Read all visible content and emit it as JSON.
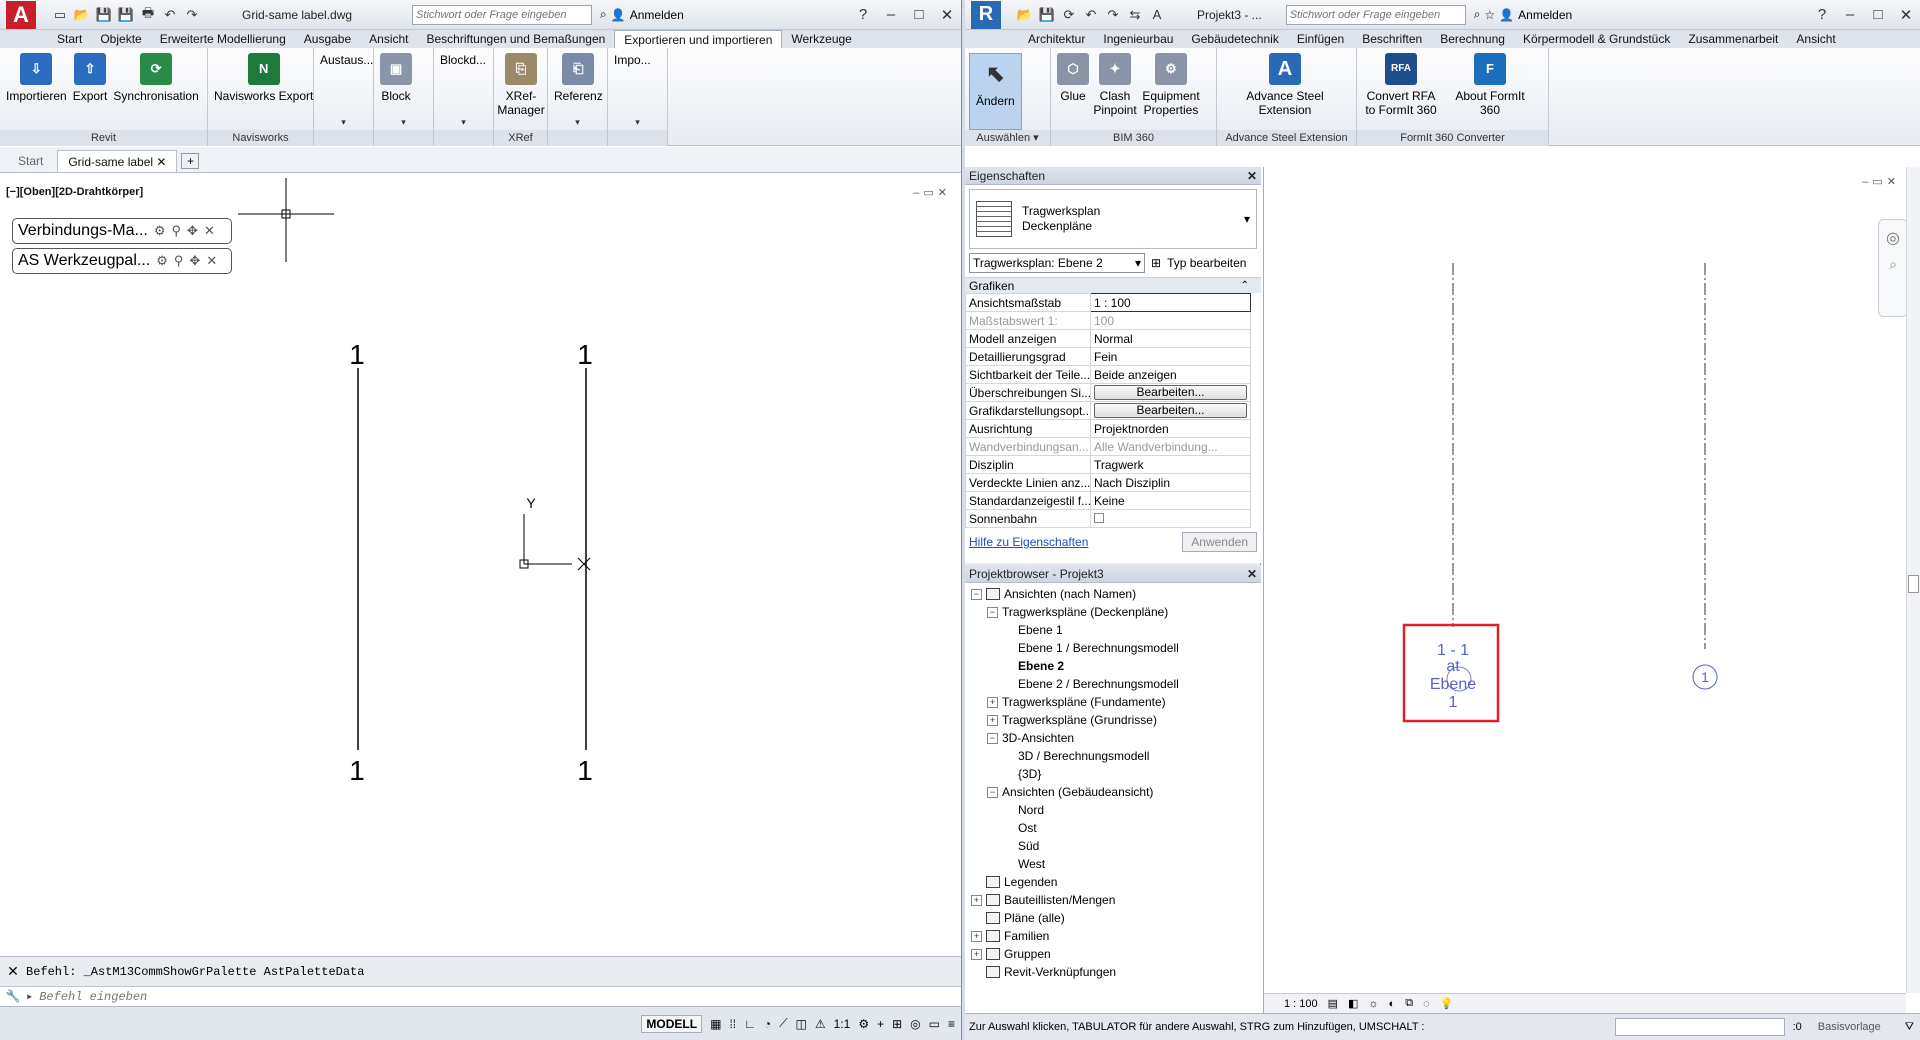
{
  "acad": {
    "app_icon": "A",
    "title": "Grid-same label.dwg",
    "search_placeholder": "Stichwort oder Frage eingeben",
    "signin": "Anmelden",
    "tabs": [
      "Start",
      "Objekte",
      "Erweiterte Modellierung",
      "Ausgabe",
      "Ansicht",
      "Beschriftungen und Bemaßungen",
      "Exportieren und importieren",
      "Werkzeuge"
    ],
    "active_tab": "Exportieren und importieren",
    "panels": [
      {
        "title": "Revit",
        "buttons": [
          "Importieren",
          "Export",
          "Synchronisation"
        ]
      },
      {
        "title": "Navisworks",
        "buttons": [
          "Navisworks Export"
        ]
      },
      {
        "title": "",
        "buttons": [
          "Austaus..."
        ]
      },
      {
        "title": "",
        "buttons": [
          "Block"
        ]
      },
      {
        "title": "",
        "buttons": [
          "Blockd..."
        ]
      },
      {
        "title": "XRef",
        "buttons": [
          "XRef-Manager"
        ]
      },
      {
        "title": "",
        "buttons": [
          "Referenz"
        ]
      },
      {
        "title": "",
        "buttons": [
          "Impo..."
        ]
      }
    ],
    "doc_tabs": [
      "Start",
      "Grid-same label"
    ],
    "viewport_label": "[−][Oben][2D-Drahtkörper]",
    "palettes": [
      "Verbindungs-Ma...",
      "AS Werkzeugpal..."
    ],
    "grid_labels": [
      "1",
      "1",
      "1",
      "1"
    ],
    "ucs_y": "Y",
    "command_history": "Befehl: _AstM13CommShowGrPalette AstPaletteData",
    "command_placeholder": "Befehl eingeben",
    "status_modell": "MODELL",
    "status_scale": "1:1"
  },
  "revit": {
    "app_icon": "R",
    "title": "Projekt3 - ...",
    "search_placeholder": "Stichwort oder Frage eingeben",
    "signin": "Anmelden",
    "tabs": [
      "Architektur",
      "Ingenieurbau",
      "Gebäudetechnik",
      "Einfügen",
      "Beschriften",
      "Berechnung",
      "Körpermodell & Grundstück",
      "Zusammenarbeit",
      "Ansicht"
    ],
    "panels": [
      {
        "title": "Auswählen",
        "buttons": [
          "Ändern"
        ]
      },
      {
        "title": "BIM 360",
        "buttons": [
          "Glue",
          "Clash Pinpoint",
          "Equipment Properties"
        ]
      },
      {
        "title": "Advance Steel Extension",
        "buttons": [
          "Advance Steel Extension"
        ]
      },
      {
        "title": "FormIt 360 Converter",
        "buttons": [
          "Convert RFA to FormIt 360",
          "About FormIt 360"
        ]
      }
    ],
    "properties": {
      "header": "Eigenschaften",
      "type_line1": "Tragwerksplan",
      "type_line2": "Deckenpläne",
      "instance": "Tragwerksplan: Ebene 2",
      "edit_type": "Typ bearbeiten",
      "group": "Grafiken",
      "rows": [
        {
          "k": "Ansichtsmaßstab",
          "v": "1 : 100"
        },
        {
          "k": "Maßstabswert 1:",
          "v": "100"
        },
        {
          "k": "Modell anzeigen",
          "v": "Normal"
        },
        {
          "k": "Detaillierungsgrad",
          "v": "Fein"
        },
        {
          "k": "Sichtbarkeit der Teile...",
          "v": "Beide anzeigen"
        },
        {
          "k": "Überschreibungen Si...",
          "v": "Bearbeiten..."
        },
        {
          "k": "Grafikdarstellungsopt...",
          "v": "Bearbeiten..."
        },
        {
          "k": "Ausrichtung",
          "v": "Projektnorden"
        },
        {
          "k": "Wandverbindungsan...",
          "v": "Alle Wandverbindung..."
        },
        {
          "k": "Disziplin",
          "v": "Tragwerk"
        },
        {
          "k": "Verdeckte Linien anz...",
          "v": "Nach Disziplin"
        },
        {
          "k": "Standardanzeigestil f...",
          "v": "Keine"
        },
        {
          "k": "Sonnenbahn",
          "v": ""
        }
      ],
      "help_link": "Hilfe zu Eigenschaften",
      "apply": "Anwenden"
    },
    "browser": {
      "header": "Projektbrowser - Projekt3",
      "nodes": [
        {
          "label": "Ansichten (nach Namen)",
          "level": 0,
          "exp": "−"
        },
        {
          "label": "Tragwerkspläne (Deckenpläne)",
          "level": 1,
          "exp": "−"
        },
        {
          "label": "Ebene 1",
          "level": 2,
          "exp": ""
        },
        {
          "label": "Ebene 1 / Berechnungsmodell",
          "level": 2,
          "exp": ""
        },
        {
          "label": "Ebene 2",
          "level": 2,
          "exp": "",
          "bold": true
        },
        {
          "label": "Ebene 2 / Berechnungsmodell",
          "level": 2,
          "exp": ""
        },
        {
          "label": "Tragwerkspläne (Fundamente)",
          "level": 1,
          "exp": "+"
        },
        {
          "label": "Tragwerkspläne (Grundrisse)",
          "level": 1,
          "exp": "+"
        },
        {
          "label": "3D-Ansichten",
          "level": 1,
          "exp": "−"
        },
        {
          "label": "3D / Berechnungsmodell",
          "level": 2,
          "exp": ""
        },
        {
          "label": "{3D}",
          "level": 2,
          "exp": ""
        },
        {
          "label": "Ansichten (Gebäudeansicht)",
          "level": 1,
          "exp": "−"
        },
        {
          "label": "Nord",
          "level": 2,
          "exp": ""
        },
        {
          "label": "Ost",
          "level": 2,
          "exp": ""
        },
        {
          "label": "Süd",
          "level": 2,
          "exp": ""
        },
        {
          "label": "West",
          "level": 2,
          "exp": ""
        },
        {
          "label": "Legenden",
          "level": 0,
          "exp": ""
        },
        {
          "label": "Bauteillisten/Mengen",
          "level": 0,
          "exp": "+"
        },
        {
          "label": "Pläne (alle)",
          "level": 0,
          "exp": ""
        },
        {
          "label": "Familien",
          "level": 0,
          "exp": "+"
        },
        {
          "label": "Gruppen",
          "level": 0,
          "exp": "+"
        },
        {
          "label": "Revit-Verknüpfungen",
          "level": 0,
          "exp": ""
        }
      ]
    },
    "grid_tag": [
      "1 - 1",
      "at",
      "Ebene",
      "1"
    ],
    "grid_bubble": "1",
    "view_scale": "1 : 100",
    "status_text": "Zur Auswahl klicken, TABULATOR für andere Auswahl, STRG zum Hinzufügen, UMSCHALT :",
    "status_zero": ":0",
    "status_workset": "Basisvorlage"
  }
}
